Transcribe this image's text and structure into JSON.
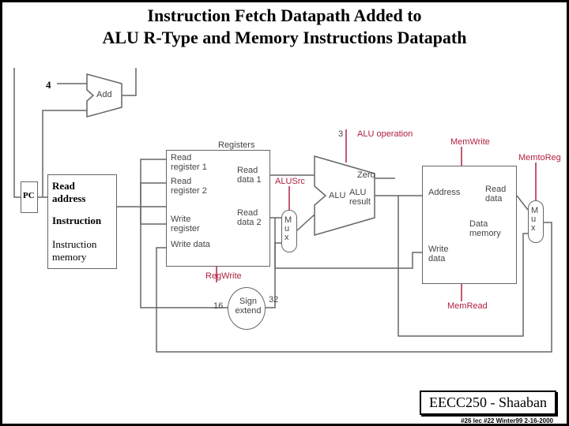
{
  "title_line1": "Instruction Fetch Datapath Added to",
  "title_line2": "ALU R-Type and Memory Instructions Datapath",
  "labels": {
    "pc": "PC",
    "four": "4",
    "add": "Add",
    "imem_addr": "Read address",
    "imem_instr": "Instruction",
    "imem_name": "Instruction memory",
    "registers": "Registers",
    "rr1": "Read register 1",
    "rr2": "Read register 2",
    "wr": "Write register",
    "wd": "Write data",
    "rd1": "Read data 1",
    "rd2": "Read data 2",
    "regwrite": "RegWrite",
    "alusrc": "ALUSrc",
    "aluop": "ALU operation",
    "aluop_w": "3",
    "zero": "Zero",
    "alures": "ALU result",
    "alu": "ALU",
    "signext": "Sign extend",
    "se_in": "16",
    "se_out": "32",
    "mux": "M u x",
    "dm_addr": "Address",
    "dm_rd": "Read data",
    "dm_wd": "Write data",
    "dm_name": "Data memory",
    "memread": "MemRead",
    "memwrite": "MemWrite",
    "memtoreg": "MemtoReg"
  },
  "footer": "EECC250 - Shaaban",
  "tiny": "#26  lec #22  Winter99  2-16-2000"
}
